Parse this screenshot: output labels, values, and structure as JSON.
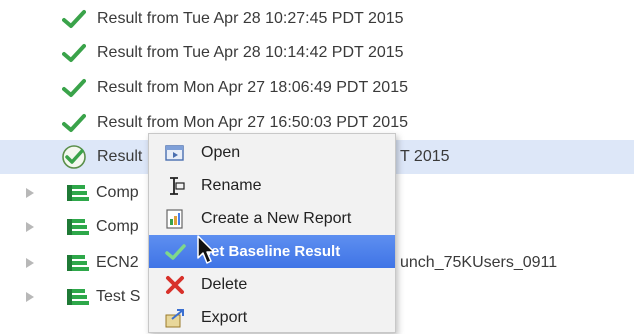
{
  "results": [
    {
      "label": "Result from Tue Apr 28 10:27:45 PDT 2015"
    },
    {
      "label": "Result from Tue Apr 28 10:14:42 PDT 2015"
    },
    {
      "label": "Result from Mon Apr 27 18:06:49 PDT 2015"
    },
    {
      "label": "Result from Mon Apr 27 16:50:03 PDT 2015"
    },
    {
      "label_left": "Result",
      "label_right": "T 2015"
    }
  ],
  "tests": [
    {
      "label": "Comp"
    },
    {
      "label": "Comp"
    },
    {
      "label_left": "ECN2",
      "label_right": "unch_75KUsers_0911"
    },
    {
      "label": "Test S"
    }
  ],
  "context_menu": {
    "items": [
      {
        "label": "Open",
        "icon": "open-icon"
      },
      {
        "label": "Rename",
        "icon": "rename-icon"
      },
      {
        "label": "Create a New Report",
        "icon": "report-icon"
      },
      {
        "label": "Set Baseline Result",
        "icon": "checkmark-icon",
        "highlighted": true
      },
      {
        "label": "Delete",
        "icon": "delete-x-icon"
      },
      {
        "label": "Export",
        "icon": "export-icon"
      }
    ]
  },
  "colors": {
    "selection": "#dde7f8",
    "menu_highlight": "#4a80ea",
    "check_green": "#3aa34a",
    "stack_green": "#2ea84a"
  }
}
